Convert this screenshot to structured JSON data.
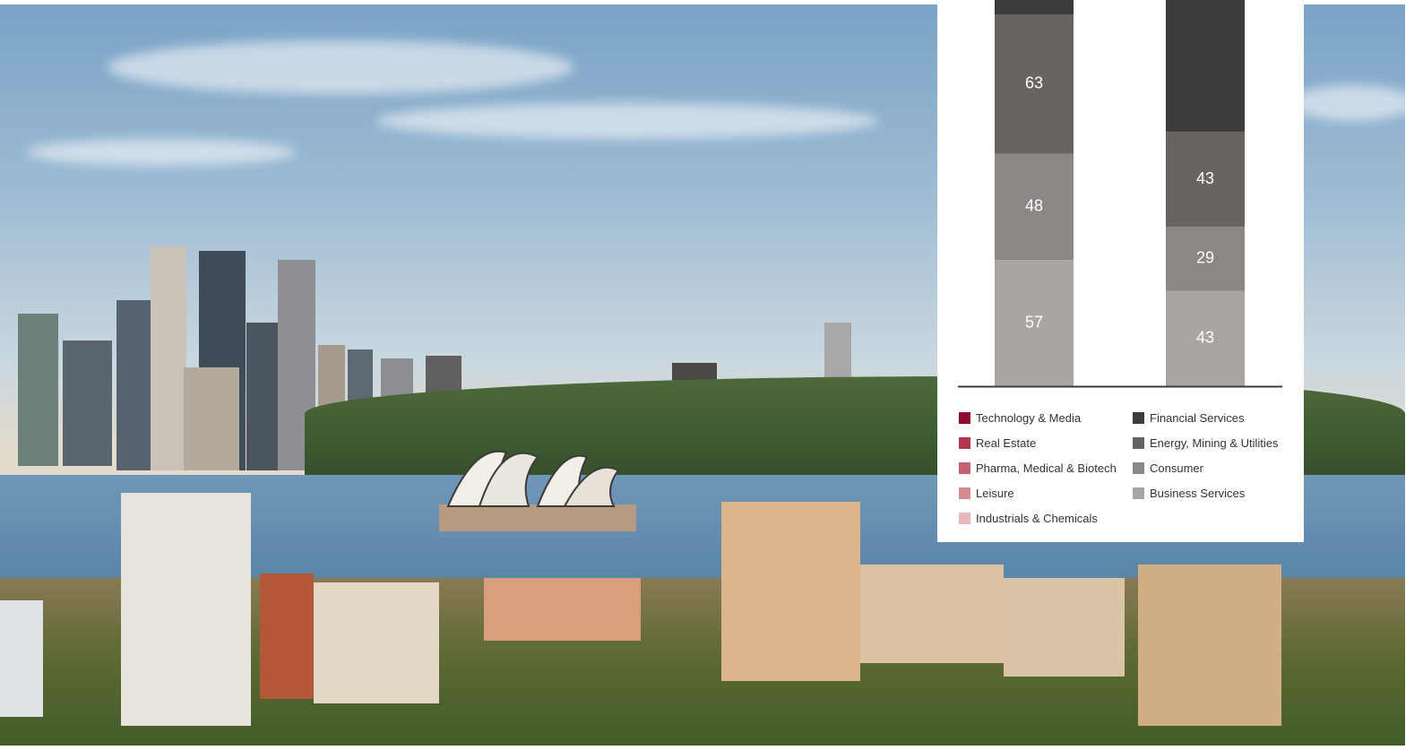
{
  "chart_data": {
    "type": "bar",
    "stacked": true,
    "series": [
      {
        "name": "Business Services",
        "color": "#a8a5a3",
        "values": [
          57,
          43
        ]
      },
      {
        "name": "Consumer",
        "color": "#8a8785",
        "values": [
          48,
          29
        ]
      },
      {
        "name": "Energy, Mining & Utilities",
        "color": "#676462",
        "values": [
          63,
          43
        ]
      },
      {
        "name": "Financial Services",
        "color": "#3d3b3a",
        "values": [
          null,
          null
        ]
      }
    ],
    "visible_data_labels": [
      {
        "bar": 0,
        "series": "Business Services",
        "value": 57
      },
      {
        "bar": 0,
        "series": "Consumer",
        "value": 48
      },
      {
        "bar": 0,
        "series": "Energy, Mining & Utilities",
        "value": 63
      },
      {
        "bar": 1,
        "series": "Business Services",
        "value": 43
      },
      {
        "bar": 1,
        "series": "Consumer",
        "value": 29
      },
      {
        "bar": 1,
        "series": "Energy, Mining & Utilities",
        "value": 43
      }
    ],
    "legend": {
      "left": [
        {
          "label": "Technology & Media",
          "color": "#8f0a2e"
        },
        {
          "label": "Real Estate",
          "color": "#b0394f"
        },
        {
          "label": "Pharma, Medical & Biotech",
          "color": "#c4626f"
        },
        {
          "label": "Leisure",
          "color": "#d58c93"
        },
        {
          "label": "Industrials & Chemicals",
          "color": "#e6b9bc"
        }
      ],
      "right": [
        {
          "label": "Financial Services",
          "color": "#3d3b3a"
        },
        {
          "label": "Energy, Mining & Utilities",
          "color": "#676462"
        },
        {
          "label": "Consumer",
          "color": "#8a8785"
        },
        {
          "label": "Business Services",
          "color": "#a8a5a3"
        }
      ]
    },
    "legend_placement": "bottom",
    "grid": false
  }
}
